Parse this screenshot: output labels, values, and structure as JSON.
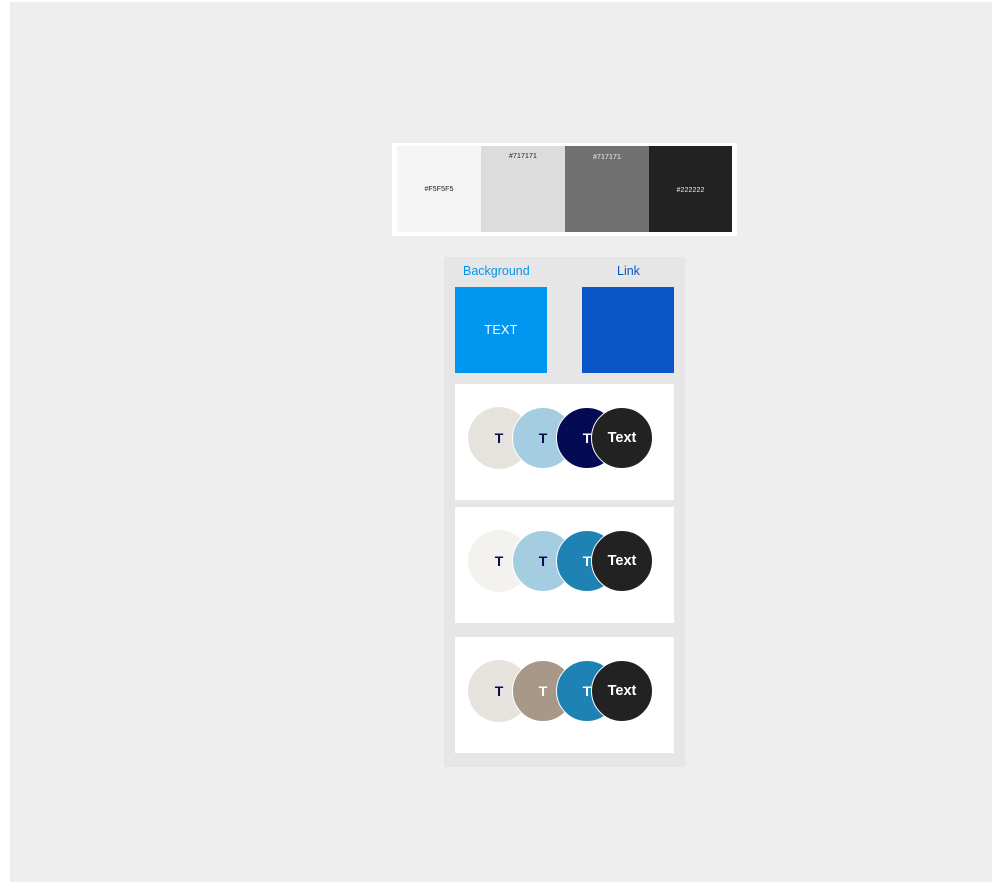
{
  "swatches": [
    {
      "label": "#F5F5F5",
      "color": "#f5f5f5"
    },
    {
      "label": "#717171",
      "color": "#dcdcdc"
    },
    {
      "label": "#717171",
      "color": "#717171"
    },
    {
      "label": "#222222",
      "color": "#222222"
    }
  ],
  "panel": {
    "background_label": "Background",
    "link_label": "Link",
    "background_box_text": "TEXT",
    "background_color": "#0096f0",
    "link_color": "#0a55c8"
  },
  "cards": [
    {
      "circles": [
        {
          "text": "T",
          "bg": "#e6e3de",
          "fg": "#0a0a50"
        },
        {
          "text": "T",
          "bg": "#a5cde1",
          "fg": "#0a0a50"
        },
        {
          "text": "T",
          "bg": "#050a55",
          "fg": "#ffffff"
        },
        {
          "text": "Text",
          "bg": "#222222",
          "fg": "#ffffff"
        }
      ]
    },
    {
      "circles": [
        {
          "text": "T",
          "bg": "#f3f2ee",
          "fg": "#0a0a50"
        },
        {
          "text": "T",
          "bg": "#a5cde1",
          "fg": "#0a0a50"
        },
        {
          "text": "T",
          "bg": "#1e82b4",
          "fg": "#ffffff"
        },
        {
          "text": "Text",
          "bg": "#222222",
          "fg": "#ffffff"
        }
      ]
    },
    {
      "circles": [
        {
          "text": "T",
          "bg": "#e6e3de",
          "fg": "#0a0a50"
        },
        {
          "text": "T",
          "bg": "#a89888",
          "fg": "#ffffff"
        },
        {
          "text": "T",
          "bg": "#1e82b4",
          "fg": "#ffffff"
        },
        {
          "text": "Text",
          "bg": "#222222",
          "fg": "#ffffff"
        }
      ]
    }
  ]
}
